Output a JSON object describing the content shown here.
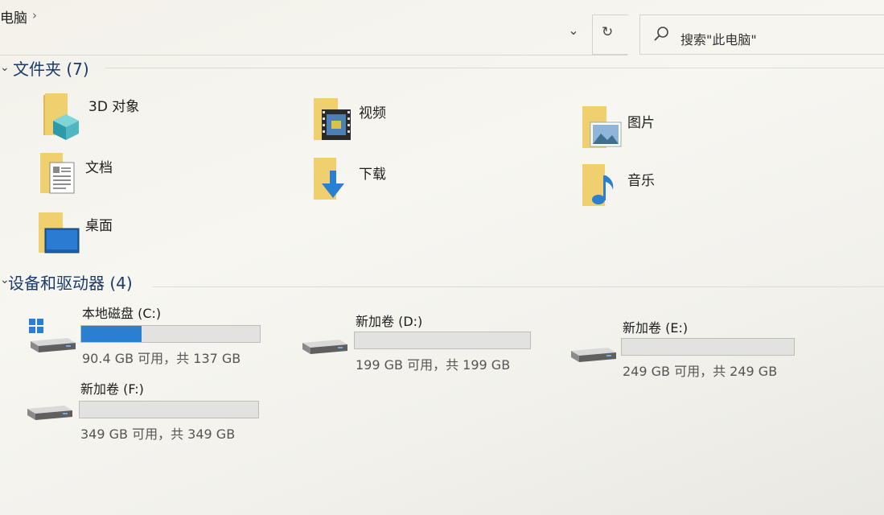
{
  "breadcrumb": {
    "location": "电脑",
    "separator": "›"
  },
  "toolbar": {
    "dropdown_glyph": "⌄",
    "refresh_glyph": "↻"
  },
  "search": {
    "placeholder": "搜索\"此电脑\""
  },
  "folders_section": {
    "title": "文件夹 (7)",
    "items": [
      {
        "label": "3D 对象",
        "icon": "3d-objects-folder-icon"
      },
      {
        "label": "视频",
        "icon": "videos-folder-icon"
      },
      {
        "label": "图片",
        "icon": "pictures-folder-icon"
      },
      {
        "label": "文档",
        "icon": "documents-folder-icon"
      },
      {
        "label": "下载",
        "icon": "downloads-folder-icon"
      },
      {
        "label": "音乐",
        "icon": "music-folder-icon"
      },
      {
        "label": "桌面",
        "icon": "desktop-folder-icon"
      }
    ]
  },
  "drives_section": {
    "title": "设备和驱动器 (4)",
    "drives": [
      {
        "name": "本地磁盘 (C:)",
        "info": "90.4 GB 可用，共 137 GB",
        "used_fraction": 0.34,
        "system": true
      },
      {
        "name": "新加卷 (D:)",
        "info": "199 GB 可用，共 199 GB",
        "used_fraction": 0.0,
        "system": false
      },
      {
        "name": "新加卷 (E:)",
        "info": "249 GB 可用，共 249 GB",
        "used_fraction": 0.0,
        "system": false
      },
      {
        "name": "新加卷 (F:)",
        "info": "349 GB 可用，共 349 GB",
        "used_fraction": 0.0,
        "system": false
      }
    ]
  },
  "colors": {
    "accent": "#2a7fd0",
    "folder": "#e8c25a",
    "section_title": "#1a3a6b"
  }
}
